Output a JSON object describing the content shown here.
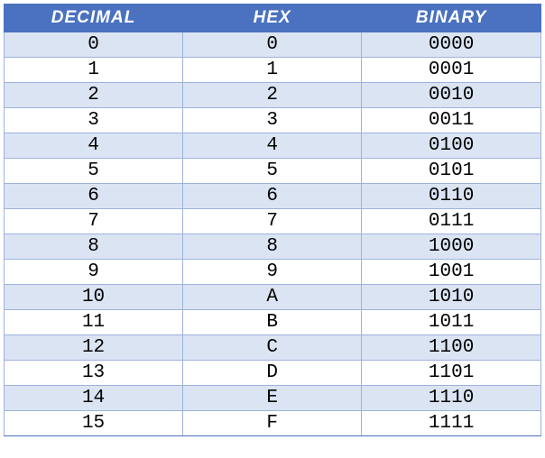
{
  "table": {
    "headers": [
      "DECIMAL",
      "HEX",
      "BINARY"
    ],
    "rows": [
      {
        "decimal": "0",
        "hex": "0",
        "binary": "0000"
      },
      {
        "decimal": "1",
        "hex": "1",
        "binary": "0001"
      },
      {
        "decimal": "2",
        "hex": "2",
        "binary": "0010"
      },
      {
        "decimal": "3",
        "hex": "3",
        "binary": "0011"
      },
      {
        "decimal": "4",
        "hex": "4",
        "binary": "0100"
      },
      {
        "decimal": "5",
        "hex": "5",
        "binary": "0101"
      },
      {
        "decimal": "6",
        "hex": "6",
        "binary": "0110"
      },
      {
        "decimal": "7",
        "hex": "7",
        "binary": "0111"
      },
      {
        "decimal": "8",
        "hex": "8",
        "binary": "1000"
      },
      {
        "decimal": "9",
        "hex": "9",
        "binary": "1001"
      },
      {
        "decimal": "10",
        "hex": "A",
        "binary": "1010"
      },
      {
        "decimal": "11",
        "hex": "B",
        "binary": "1011"
      },
      {
        "decimal": "12",
        "hex": "C",
        "binary": "1100"
      },
      {
        "decimal": "13",
        "hex": "D",
        "binary": "1101"
      },
      {
        "decimal": "14",
        "hex": "E",
        "binary": "1110"
      },
      {
        "decimal": "15",
        "hex": "F",
        "binary": "1111"
      }
    ]
  }
}
